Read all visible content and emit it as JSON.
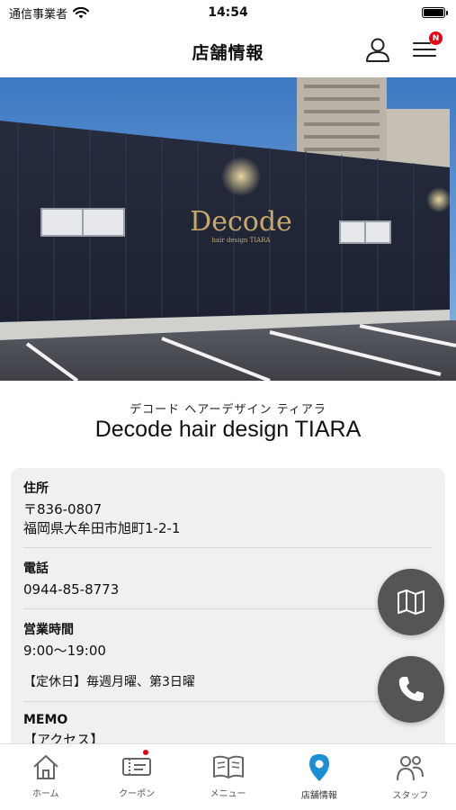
{
  "status_bar": {
    "carrier": "通信事業者",
    "time": "14:54"
  },
  "header": {
    "title": "店舗情報",
    "notification_badge": "N"
  },
  "hero": {
    "sign_main": "Decode",
    "sign_sub": "hair design TIARA"
  },
  "shop": {
    "kana": "デコード ヘアーデザイン ティアラ",
    "name": "Decode hair design TIARA"
  },
  "info": {
    "address_label": "住所",
    "postal": "〒836-0807",
    "address": "福岡県大牟田市旭町1-2-1",
    "phone_label": "電話",
    "phone": "0944-85-8773",
    "hours_label": "営業時間",
    "hours": "9:00〜19:00",
    "holiday": "【定休日】毎週月曜、第3日曜",
    "memo_label": "MEMO",
    "memo_value": "【アクセス】"
  },
  "tabs": [
    {
      "label": "ホーム",
      "icon": "home-icon"
    },
    {
      "label": "クーポン",
      "icon": "coupon-icon"
    },
    {
      "label": "メニュー",
      "icon": "menu-book-icon"
    },
    {
      "label": "店舗情報",
      "icon": "location-pin-icon"
    },
    {
      "label": "スタッフ",
      "icon": "staff-icon"
    }
  ],
  "colors": {
    "accent": "#1a8fd6",
    "badge": "#e60012",
    "fab": "#555558"
  }
}
